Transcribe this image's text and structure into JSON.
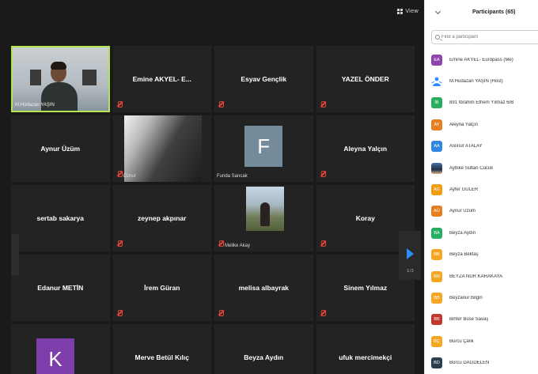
{
  "topbar": {
    "view_label": "View"
  },
  "tiles": [
    {
      "name": "M.Hüdazan YAŞIN",
      "kind": "video-self",
      "muted": false
    },
    {
      "name": "Emine AKYEL- E...",
      "kind": "name",
      "muted": true
    },
    {
      "name": "Esyav Gençlik",
      "kind": "name",
      "muted": true
    },
    {
      "name": "YAZEL ÖNDER",
      "kind": "name",
      "muted": true
    },
    {
      "name": "Aynur Üzüm",
      "kind": "name",
      "muted": false
    },
    {
      "name": "Öznur",
      "kind": "video-oznur",
      "muted": true
    },
    {
      "name": "Funda Sancak",
      "kind": "av-f",
      "initial": "F",
      "muted": false
    },
    {
      "name": "Aleyna Yalçın",
      "kind": "name",
      "muted": true
    },
    {
      "name": "sertab sakarya",
      "kind": "name",
      "muted": false
    },
    {
      "name": "zeynep akpınar",
      "kind": "name",
      "muted": true
    },
    {
      "name": "Melike Akay",
      "kind": "video-melike",
      "muted": true
    },
    {
      "name": "Koray",
      "kind": "name",
      "muted": true
    },
    {
      "name": "Edanur METİN",
      "kind": "name",
      "muted": false
    },
    {
      "name": "İrem Güran",
      "kind": "name",
      "muted": true
    },
    {
      "name": "melisa albayrak",
      "kind": "name",
      "muted": true
    },
    {
      "name": "Sinem Yılmaz",
      "kind": "name",
      "muted": true
    },
    {
      "name": "",
      "kind": "av-k",
      "initial": "K",
      "muted": false
    },
    {
      "name": "Merve Betül Kılıç",
      "kind": "name",
      "muted": false
    },
    {
      "name": "Beyza Aydın",
      "kind": "name",
      "muted": false
    },
    {
      "name": "ufuk mercimekçi",
      "kind": "name",
      "muted": false
    }
  ],
  "pager": {
    "label": "1/3"
  },
  "panel": {
    "title": "Participants (65)",
    "search_placeholder": "Find a participant",
    "participants": [
      {
        "initials": "EA",
        "color": "#8e44ad",
        "name": "Emine AKYEL- Europass (Me)"
      },
      {
        "initials": "",
        "color": "#ffffff",
        "name": "M.Hüdazan YAŞIN (Host)",
        "icon": "zoom-person-icon"
      },
      {
        "initials": "İB",
        "color": "#27ae60",
        "name": "891 İbrahim Ethem Yılmaz 6/B"
      },
      {
        "initials": "AY",
        "color": "#e67e22",
        "name": "Aleyna Yalçın"
      },
      {
        "initials": "AA",
        "color": "#2e86de",
        "name": "Aslınur ATALAY"
      },
      {
        "initials": "",
        "color": "#2c3e50",
        "name": "Aybike Sultan Cücük",
        "icon": "photo-avatar-icon"
      },
      {
        "initials": "AG",
        "color": "#f39c12",
        "name": "Ayfer GÜLER"
      },
      {
        "initials": "AÜ",
        "color": "#e67e22",
        "name": "Aynur Üzüm"
      },
      {
        "initials": "BA",
        "color": "#27ae60",
        "name": "Beyza Aydın"
      },
      {
        "initials": "BB",
        "color": "#f5a623",
        "name": "Beyza Bektaş"
      },
      {
        "initials": "BN",
        "color": "#f5a623",
        "name": "BEYZA NUR KARAKAYA"
      },
      {
        "initials": "BB",
        "color": "#f5a623",
        "name": "Beyzanur Bilgin"
      },
      {
        "initials": "BB",
        "color": "#c0392b",
        "name": "Bihter Buse Savaş"
      },
      {
        "initials": "BÇ",
        "color": "#f5a623",
        "name": "Burcu Çelik"
      },
      {
        "initials": "BD",
        "color": "#2c3e50",
        "name": "Burcu DAĞDELEN"
      }
    ]
  }
}
